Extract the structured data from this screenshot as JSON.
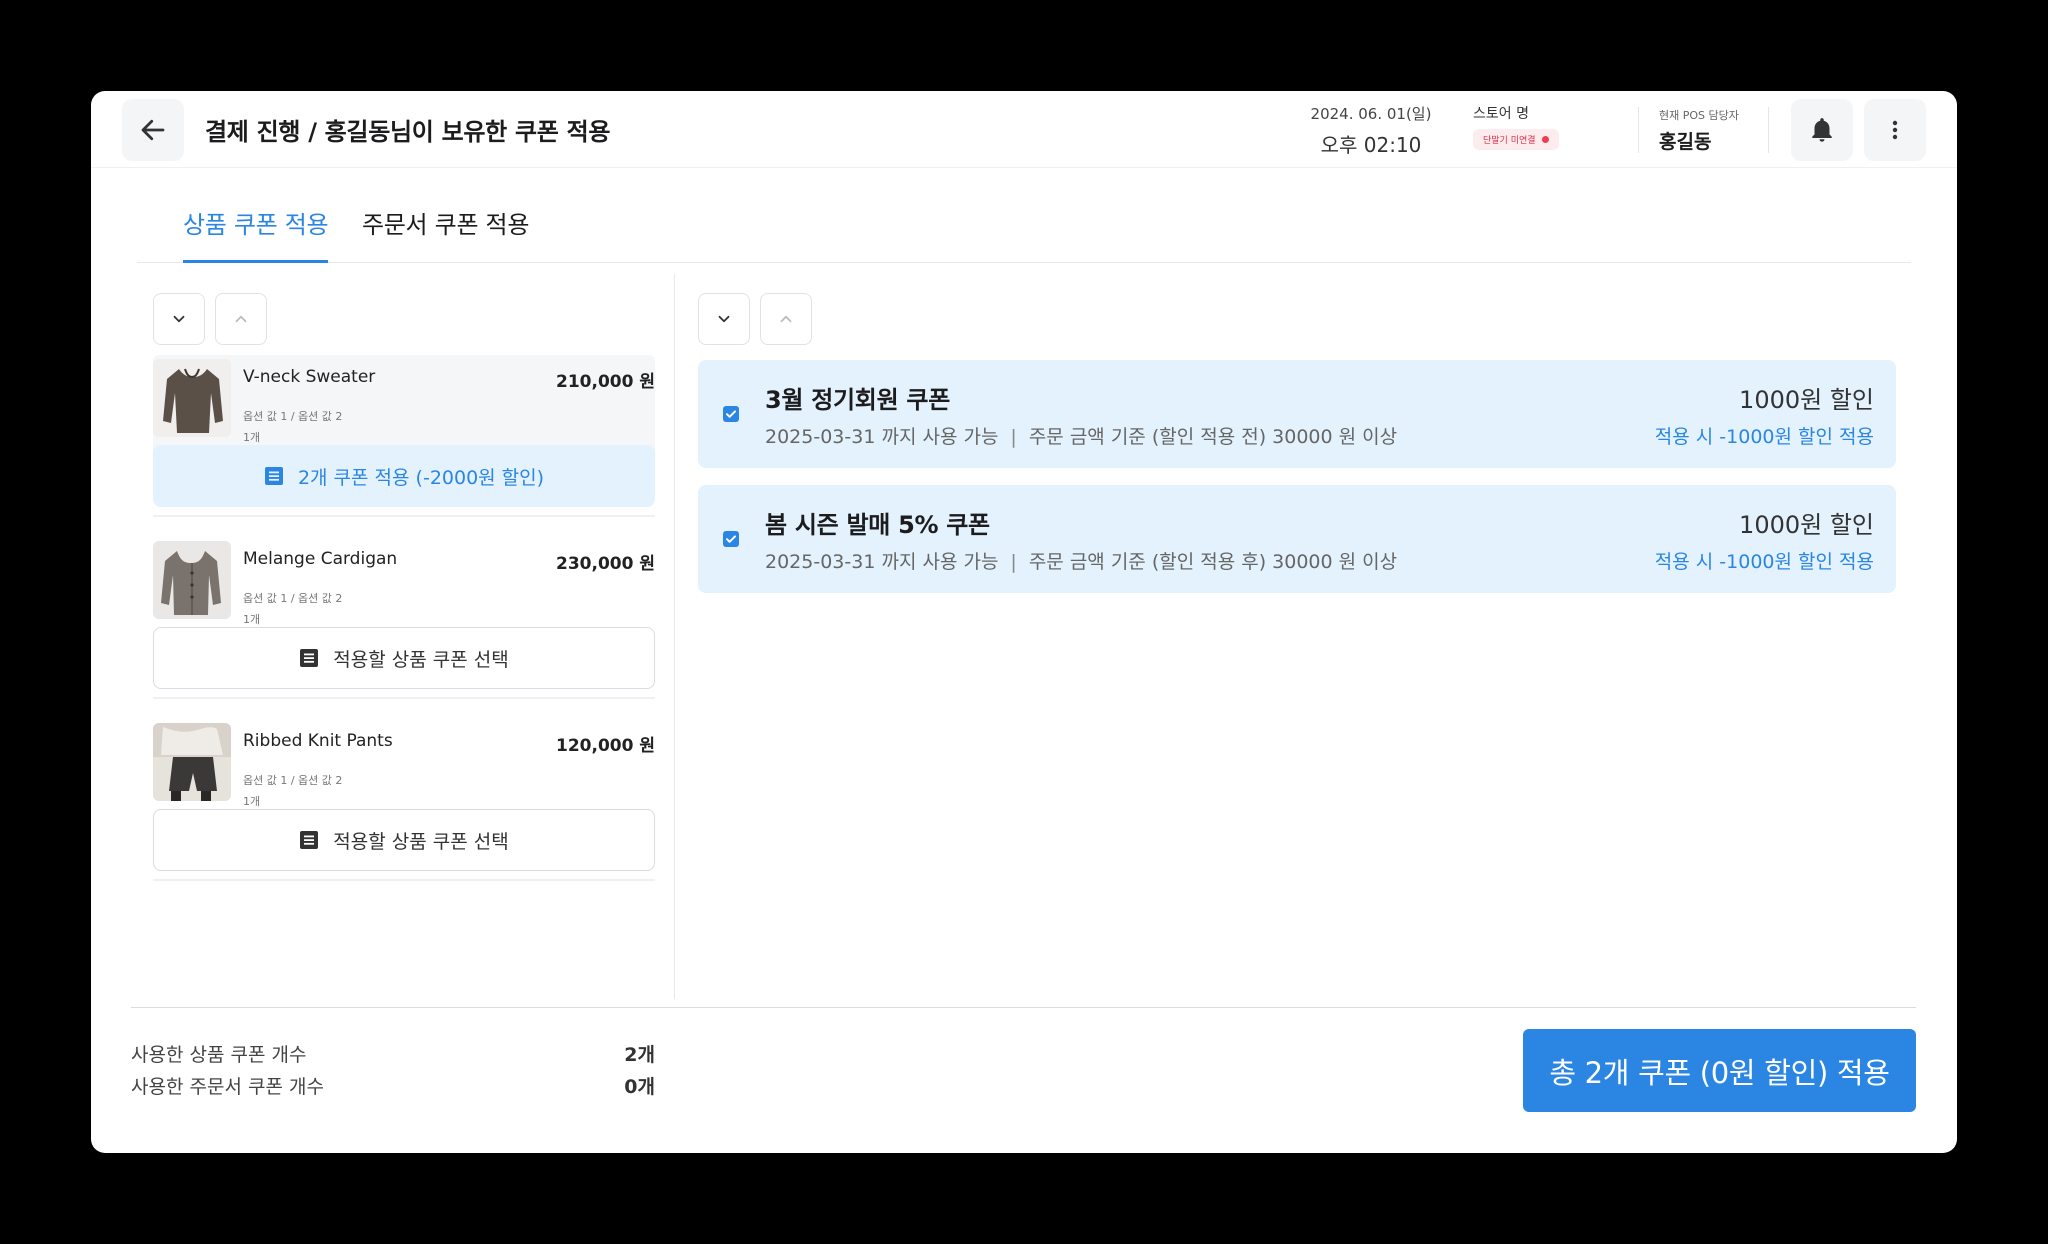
{
  "header": {
    "title_main": "결제 진행",
    "title_sep": "/",
    "title_sub": "홍길동님이 보유한 쿠폰 적용",
    "date": "2024. 06. 01(일)",
    "time": "오후 02:10",
    "store_label": "스토어 명",
    "store_status": "단말기 미연결",
    "staff_label": "현재 POS 담당자",
    "staff_name": "홍길동"
  },
  "tabs": [
    {
      "label": "상품 쿠폰 적용",
      "active": true
    },
    {
      "label": "주문서 쿠폰 적용",
      "active": false
    }
  ],
  "products": [
    {
      "name": "V-neck Sweater",
      "price": "210,000 원",
      "options": "옵션 값 1 / 옵션 값 2",
      "qty": "1개",
      "coupon_label": "2개 쿠폰 적용 (-2000원 할인)",
      "applied": true
    },
    {
      "name": "Melange Cardigan",
      "price": "230,000 원",
      "options": "옵션 값 1 / 옵션 값 2",
      "qty": "1개",
      "coupon_label": "적용할 상품 쿠폰 선택",
      "applied": false
    },
    {
      "name": "Ribbed Knit Pants",
      "price": "120,000 원",
      "options": "옵션 값 1 / 옵션 값 2",
      "qty": "1개",
      "coupon_label": "적용할 상품 쿠폰 선택",
      "applied": false
    }
  ],
  "coupons": [
    {
      "name": "3월 정기회원 쿠폰",
      "valid": "2025-03-31 까지 사용 가능",
      "bar": "|",
      "condition": "주문 금액 기준 (할인 적용 전) 30000 원 이상",
      "amount": "1000원 할인",
      "applied": "적용 시 -1000원 할인 적용",
      "checked": true
    },
    {
      "name": "봄 시즌 발매 5% 쿠폰",
      "valid": "2025-03-31 까지 사용 가능",
      "bar": "|",
      "condition": "주문 금액 기준 (할인 적용 후) 30000 원 이상",
      "amount": "1000원 할인",
      "applied": "적용 시 -1000원 할인 적용",
      "checked": true
    }
  ],
  "summary": {
    "product_label": "사용한 상품 쿠폰 개수",
    "product_value": "2개",
    "order_label": "사용한 주문서 쿠폰 개수",
    "order_value": "0개"
  },
  "apply_button": "총 2개 쿠폰 (0원 할인) 적용",
  "colors": {
    "accent": "#2b86e3",
    "coupon_bg": "#e3f2fd",
    "status_red": "#ef3b4f"
  },
  "icons": [
    "back-arrow-icon",
    "bell-icon",
    "more-vertical-icon",
    "chevron-down-icon",
    "chevron-up-icon",
    "list-icon",
    "checkbox-checked-icon"
  ]
}
